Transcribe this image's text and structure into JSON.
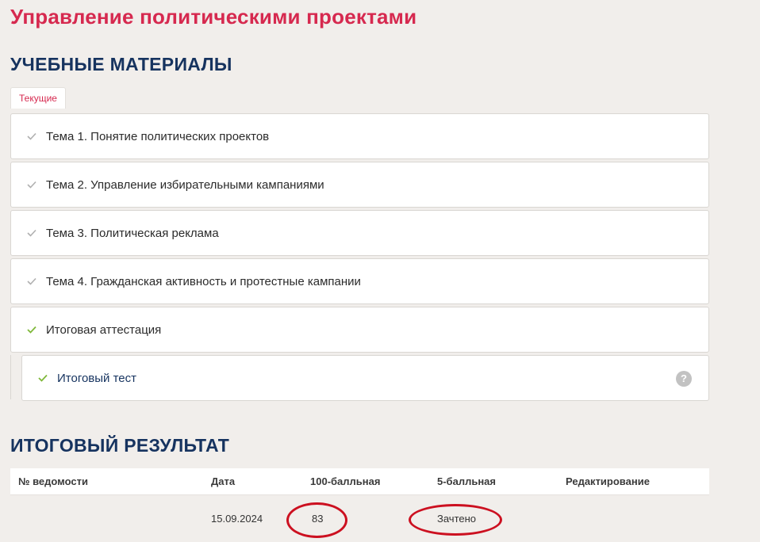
{
  "course": {
    "title": "Управление политическими проектами"
  },
  "materials": {
    "title": "УЧЕБНЫЕ МАТЕРИАЛЫ",
    "tab_current": "Текущие",
    "topics": [
      {
        "label": "Тема 1. Понятие политических проектов",
        "status": "completed-grey"
      },
      {
        "label": "Тема 2. Управление избирательными кампаниями",
        "status": "completed-grey"
      },
      {
        "label": "Тема 3. Политическая реклама",
        "status": "completed-grey"
      },
      {
        "label": "Тема 4. Гражданская активность и протестные кампании",
        "status": "completed-grey"
      },
      {
        "label": "Итоговая аттестация",
        "status": "completed-green"
      }
    ],
    "subitem": {
      "label": "Итоговый тест",
      "status": "completed-green",
      "help_icon": "?"
    }
  },
  "results": {
    "title": "ИТОГОВЫЙ РЕЗУЛЬТАТ",
    "headers": [
      "№ ведомости",
      "Дата",
      "100-балльная",
      "5-балльная",
      "Редактирование"
    ],
    "rows": [
      {
        "statement_no": "",
        "date": "15.09.2024",
        "score100": "83",
        "score5": "Зачтено",
        "edit": ""
      }
    ]
  },
  "colors": {
    "accent_red": "#d6294f",
    "heading_navy": "#16335f",
    "check_grey": "#b0b0b0",
    "check_green": "#7fb83a",
    "annotation_red": "#cc1020",
    "background": "#f1eeeb"
  }
}
